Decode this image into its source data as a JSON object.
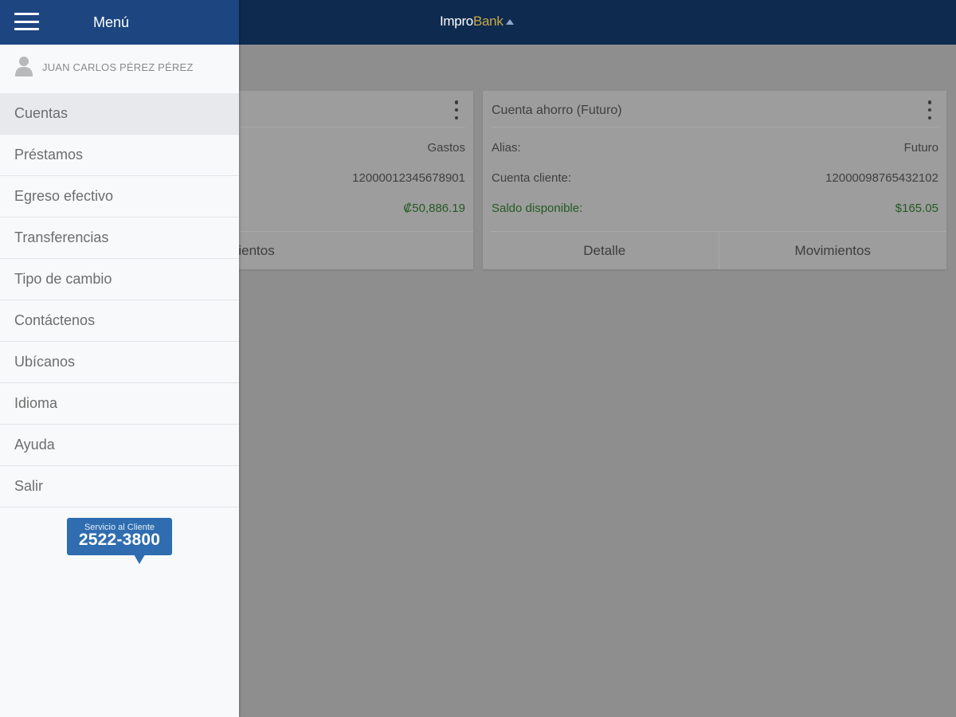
{
  "header": {
    "logo_part1": "Impro",
    "logo_part2": "Bank"
  },
  "drawer": {
    "title": "Menú",
    "user_name": "JUAN CARLOS PÉREZ PÉREZ",
    "items": [
      {
        "label": "Cuentas",
        "active": true
      },
      {
        "label": "Préstamos"
      },
      {
        "label": "Egreso efectivo"
      },
      {
        "label": "Transferencias"
      },
      {
        "label": "Tipo de cambio"
      },
      {
        "label": "Contáctenos"
      },
      {
        "label": "Ubícanos"
      },
      {
        "label": "Idioma"
      },
      {
        "label": "Ayuda"
      },
      {
        "label": "Salir"
      }
    ],
    "service": {
      "label": "Servicio al Cliente",
      "phone": "2522-3800"
    }
  },
  "accounts": [
    {
      "alias": "Gastos",
      "account_number": "12000012345678901",
      "balance": "₡50,886.19",
      "actions": [
        "Movimientos"
      ]
    },
    {
      "title": "Cuenta ahorro (Futuro)",
      "alias_label": "Alias:",
      "alias": "Futuro",
      "account_label": "Cuenta cliente:",
      "account_number": "12000098765432102",
      "balance_label": "Saldo disponible:",
      "balance": "$165.05",
      "actions": [
        "Detalle",
        "Movimientos"
      ]
    }
  ],
  "colors": {
    "topbar": "#0e2a4f",
    "drawer_header": "#1d4681",
    "service_badge": "#2f6db0",
    "balance_green": "#245a24"
  }
}
